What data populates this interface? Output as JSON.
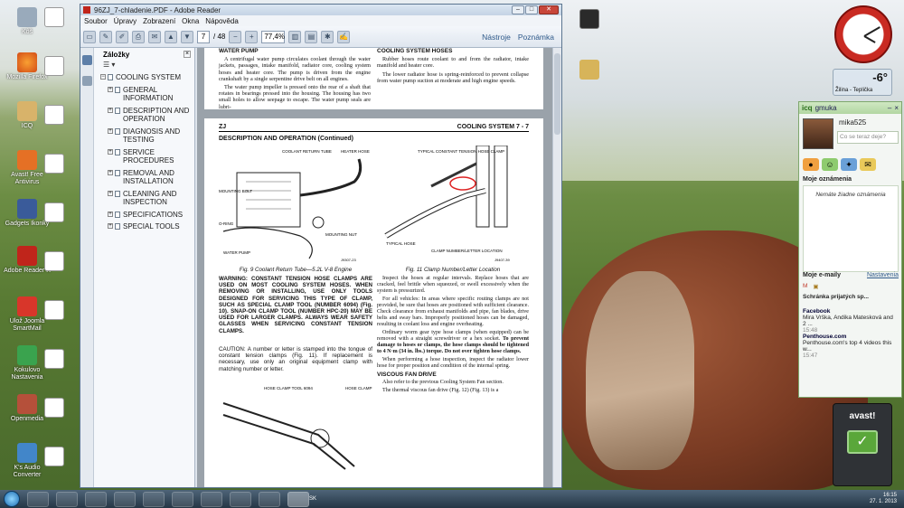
{
  "reader": {
    "title": "96ZJ_7-chladenie.PDF - Adobe Reader",
    "menu": [
      "Soubor",
      "Úpravy",
      "Zobrazení",
      "Okna",
      "Nápověda"
    ],
    "page_current": "7",
    "page_total": "/ 48",
    "zoom": "77,4%",
    "tools_label": "Nástroje",
    "comment_label": "Poznámka"
  },
  "sidebar": {
    "title": "Záložky",
    "root": "COOLING SYSTEM",
    "items": [
      "GENERAL INFORMATION",
      "DESCRIPTION AND OPERATION",
      "DIAGNOSIS AND TESTING",
      "SERVICE PROCEDURES",
      "REMOVAL AND INSTALLATION",
      "CLEANING AND INSPECTION",
      "SPECIFICATIONS",
      "SPECIAL TOOLS"
    ]
  },
  "doc": {
    "p1_col1_head": "WATER PUMP",
    "p1_col1_text": "A centrifugal water pump circulates coolant through the water jackets, passages, intake manifold, radiator core, cooling system hoses and heater core. The pump is driven from the engine crankshaft by a single serpentine drive belt on all engines.",
    "p1_col1_text2": "The water pump impeller is pressed onto the rear of a shaft that rotates in bearings pressed into the housing. The housing has two small holes to allow seepage to escape. The water pump seals are lubri-",
    "p1_col2_head": "COOLING SYSTEM HOSES",
    "p1_col2_text": "Rubber hoses route coolant to and from the radiator, intake manifold and heater core.",
    "p1_col2_text2": "The lower radiator hose is spring-reinforced to prevent collapse from water pump suction at moderate and high engine speeds.",
    "p2_left": "ZJ",
    "p2_right": "COOLING SYSTEM    7 - 7",
    "p2_title": "DESCRIPTION AND OPERATION (Continued)",
    "fig9_caption": "Fig. 9 Coolant Return Tube—5.2L V-8 Engine",
    "fig11_caption": "Fig. 11 Clamp Number/Letter Location",
    "fig9_labels": [
      "COOLANT RETURN TUBE",
      "HEATER HOSE",
      "MOUNTING BOLT",
      "O-RING",
      "MOUNTING NUT",
      "WATER PUMP",
      "J9307-23"
    ],
    "fig11_labels": [
      "TYPICAL CONSTANT TENSION HOSE CLAMP",
      "TYPICAL HOSE",
      "CLAMP NUMBER/LETTER LOCATION",
      "J9407-39"
    ],
    "warning": "WARNING: CONSTANT TENSION HOSE CLAMPS ARE USED ON MOST COOLING SYSTEM HOSES. WHEN REMOVING OR INSTALLING, USE ONLY TOOLS DESIGNED FOR SERVICING THIS TYPE OF CLAMP, SUCH AS SPECIAL CLAMP TOOL (NUMBER 6094) (Fig. 10). SNAP-ON CLAMP TOOL (NUMBER HPC-20) MAY BE USED FOR LARGER CLAMPS. ALWAYS WEAR SAFETY GLASSES WHEN SERVICING CONSTANT TENSION CLAMPS.",
    "caution": "CAUTION: A number or letter is stamped into the tongue of constant tension clamps (Fig. 11). If replacement is necessary, use only an original equipment clamp with matching number or letter.",
    "fig10_labels": [
      "HOSE CLAMP TOOL 6094",
      "HOSE CLAMP"
    ],
    "right_col_text": "Inspect the hoses at regular intervals. Replace hoses that are cracked, feel brittle when squeezed, or swell excessively when the system is pressurized.",
    "right_col_text2": "For all vehicles: In areas where specific routing clamps are not provided, be sure that hoses are positioned with sufficient clearance. Check clearance from exhaust manifolds and pipe, fan blades, drive belts and sway bars. Improperly positioned hoses can be damaged, resulting in coolant loss and engine overheating.",
    "right_col_text3": "Ordinary worm gear type hose clamps (when equipped) can be removed with a straight screwdriver or a hex socket.",
    "right_col_bold": "To prevent damage to hoses or clamps, the hose clamps should be tightened to 4 N·m (34 in. lbs.) torque. Do not over tighten hose clamps.",
    "right_col_text4": "When performing a hose inspection, inspect the radiator lower hose for proper position and condition of the internal spring.",
    "fan_head": "VISCOUS FAN DRIVE",
    "fan_text": "Also refer to the previous Cooling System Fan section.",
    "fan_text2": "The thermal viscous fan drive (Fig. 12) (Fig. 13) is a"
  },
  "icq": {
    "title": "icq",
    "user": "gmuka",
    "contact": "mika525",
    "status_placeholder": "Co se teraz deje?",
    "notif_head": "Moje oznámenia",
    "notif_empty": "Nemáte žiadne oznámenia",
    "mail_head": "Moje e-maily",
    "mail_link": "Nastavenia",
    "inbox": "Schránka prijatých sp...",
    "mails": [
      {
        "from": "Facebook",
        "text": "Mira Vrška, Andika Matesková and 2 ...",
        "time": "15:48"
      },
      {
        "from": "Penthouse.com",
        "text": "Penthouse.com's top 4 videos this w...",
        "time": "15:47"
      }
    ]
  },
  "weather": {
    "temp": "-6°",
    "loc": "Žilina - Teplička"
  },
  "desktop_icons": [
    "Kôš",
    "Mozilla Firefox",
    "ICQ",
    "Avast! Free Antivirus",
    "Gadgets Ikonky",
    "Adobe Reader X",
    "Ulož Joomla SmartMail",
    "Kokulovo Nastavenia",
    "Openmedia",
    "K's Audio Converter"
  ],
  "avast_label": "avast!",
  "tray": {
    "lang": "SK",
    "time": "16:15",
    "date": "27. 1. 2013"
  },
  "colors": {
    "accent": "#2f5a8a",
    "icq_green": "#2b6f1c",
    "clock_red": "#c92a22"
  }
}
